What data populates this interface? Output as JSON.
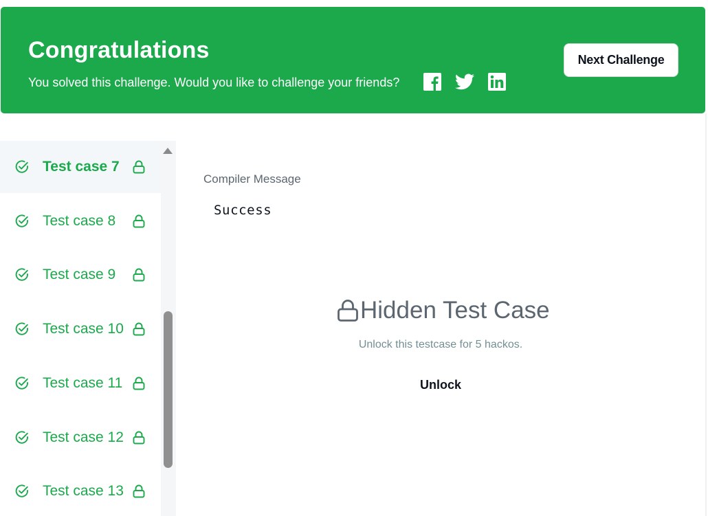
{
  "banner": {
    "title": "Congratulations",
    "subtitle": "You solved this challenge. Would you like to challenge your friends?",
    "share_icons": [
      "facebook-icon",
      "twitter-icon",
      "linkedin-icon"
    ],
    "next_button": "Next Challenge",
    "color": "#1ba94c"
  },
  "sidebar": {
    "items": [
      {
        "label": "Test case 7",
        "status": "passed",
        "locked": true,
        "active": true
      },
      {
        "label": "Test case 8",
        "status": "passed",
        "locked": true
      },
      {
        "label": "Test case 9",
        "status": "passed",
        "locked": true
      },
      {
        "label": "Test case 10",
        "status": "passed",
        "locked": true
      },
      {
        "label": "Test case 11",
        "status": "passed",
        "locked": true
      },
      {
        "label": "Test case 12",
        "status": "passed",
        "locked": true
      },
      {
        "label": "Test case 13",
        "status": "passed",
        "locked": true
      }
    ],
    "pass_color": "#1ba94c"
  },
  "main": {
    "compiler_label": "Compiler Message",
    "compiler_message": "Success",
    "hidden_title": "Hidden Test Case",
    "hidden_desc": "Unlock this testcase for 5 hackos.",
    "unlock_button": "Unlock"
  }
}
